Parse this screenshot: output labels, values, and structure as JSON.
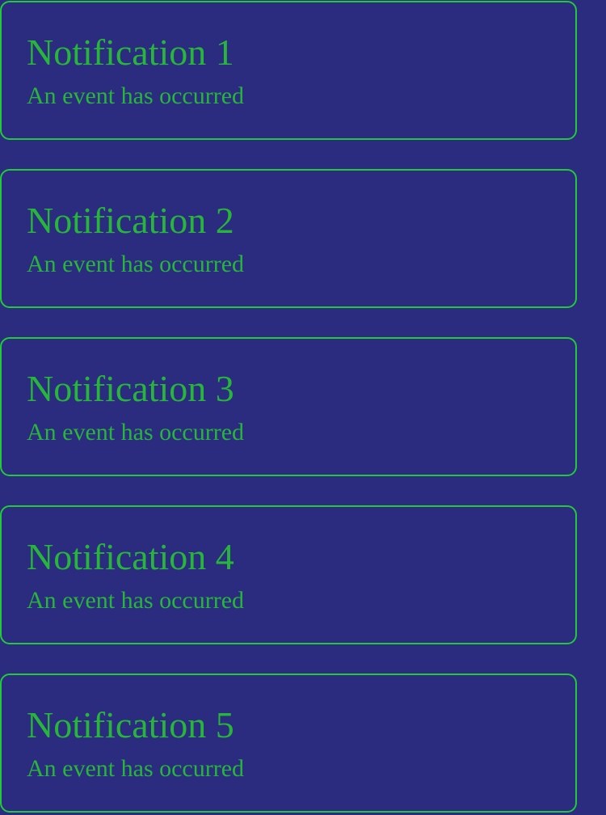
{
  "notifications": [
    {
      "title": "Notification 1",
      "message": "An event has occurred"
    },
    {
      "title": "Notification 2",
      "message": "An event has occurred"
    },
    {
      "title": "Notification 3",
      "message": "An event has occurred"
    },
    {
      "title": "Notification 4",
      "message": "An event has occurred"
    },
    {
      "title": "Notification 5",
      "message": "An event has occurred"
    }
  ],
  "colors": {
    "background": "#2b2c80",
    "border": "#22c93a",
    "text": "#27b63a"
  }
}
